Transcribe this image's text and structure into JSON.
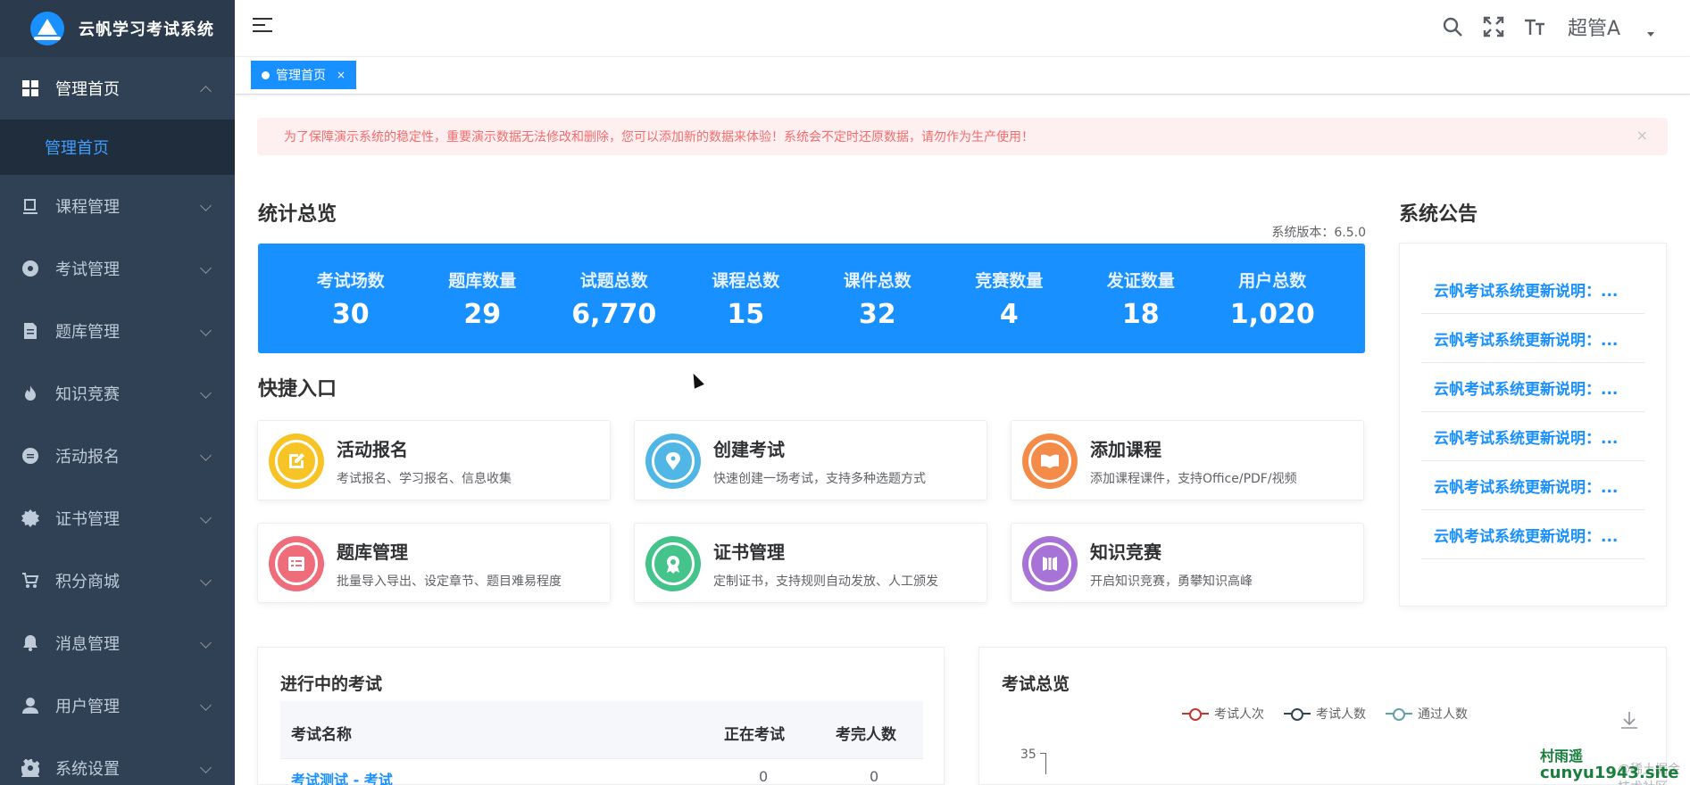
{
  "app": {
    "title": "云帆学习考试系统"
  },
  "sidebar": {
    "items": [
      {
        "label": "管理首页",
        "icon": "dashboard-icon",
        "open": true,
        "children": [
          {
            "label": "管理首页",
            "active": true
          }
        ]
      },
      {
        "label": "课程管理",
        "icon": "course-icon"
      },
      {
        "label": "考试管理",
        "icon": "exam-icon"
      },
      {
        "label": "题库管理",
        "icon": "question-bank-icon"
      },
      {
        "label": "知识竞赛",
        "icon": "fire-icon"
      },
      {
        "label": "活动报名",
        "icon": "activity-icon"
      },
      {
        "label": "证书管理",
        "icon": "certificate-icon"
      },
      {
        "label": "积分商城",
        "icon": "cart-icon"
      },
      {
        "label": "消息管理",
        "icon": "bell-icon"
      },
      {
        "label": "用户管理",
        "icon": "user-icon"
      },
      {
        "label": "系统设置",
        "icon": "settings-icon"
      }
    ]
  },
  "header": {
    "user": "超管A",
    "icons": [
      "search-icon",
      "fullscreen-icon",
      "font-size-icon"
    ]
  },
  "tags": [
    {
      "label": "管理首页",
      "close": "×"
    }
  ],
  "alert": {
    "text": "为了保障演示系统的稳定性，重要演示数据无法修改和删除，您可以添加新的数据来体验！系统会不定时还原数据，请勿作为生产使用！",
    "close": "×"
  },
  "stats": {
    "title": "统计总览",
    "version": "系统版本：6.5.0",
    "items": [
      {
        "label": "考试场数",
        "value": "30"
      },
      {
        "label": "题库数量",
        "value": "29"
      },
      {
        "label": "试题总数",
        "value": "6,770"
      },
      {
        "label": "课程总数",
        "value": "15"
      },
      {
        "label": "课件总数",
        "value": "32"
      },
      {
        "label": "竞赛数量",
        "value": "4"
      },
      {
        "label": "发证数量",
        "value": "18"
      },
      {
        "label": "用户总数",
        "value": "1,020"
      }
    ]
  },
  "quick": {
    "title": "快捷入口",
    "items": [
      {
        "title": "活动报名",
        "desc": "考试报名、学习报名、信息收集",
        "color": "#f7c325"
      },
      {
        "title": "创建考试",
        "desc": "快速创建一场考试，支持多种选题方式",
        "color": "#4fb6e6"
      },
      {
        "title": "添加课程",
        "desc": "添加课程课件，支持Office/PDF/视频",
        "color": "#f58b49"
      },
      {
        "title": "题库管理",
        "desc": "批量导入导出、设定章节、题目难易程度",
        "color": "#ef6d7b"
      },
      {
        "title": "证书管理",
        "desc": "定制证书，支持规则自动发放、人工颁发",
        "color": "#44c48a"
      },
      {
        "title": "知识竞赛",
        "desc": "开启知识竞赛，勇攀知识高峰",
        "color": "#a873d6"
      }
    ]
  },
  "notices": {
    "title": "系统公告",
    "items": [
      "云帆考试系统更新说明：...",
      "云帆考试系统更新说明：...",
      "云帆考试系统更新说明：...",
      "云帆考试系统更新说明：...",
      "云帆考试系统更新说明：...",
      "云帆考试系统更新说明：..."
    ]
  },
  "ongoing": {
    "title": "进行中的考试",
    "columns": [
      "考试名称",
      "正在考试",
      "考完人数"
    ],
    "rows": [
      {
        "name": "考试测试 - 考试",
        "doing": "0",
        "done": "0"
      }
    ]
  },
  "overview": {
    "title": "考试总览",
    "legend": [
      {
        "name": "考试人次",
        "color": "#c23531"
      },
      {
        "name": "考试人数",
        "color": "#2f4554"
      },
      {
        "name": "通过人数",
        "color": "#61a0a8"
      }
    ],
    "y_tick": "35"
  },
  "watermark": {
    "line1": "村雨遥",
    "line2": "cunyu1943.site",
    "sub": "@稀土掘金技术社区"
  }
}
